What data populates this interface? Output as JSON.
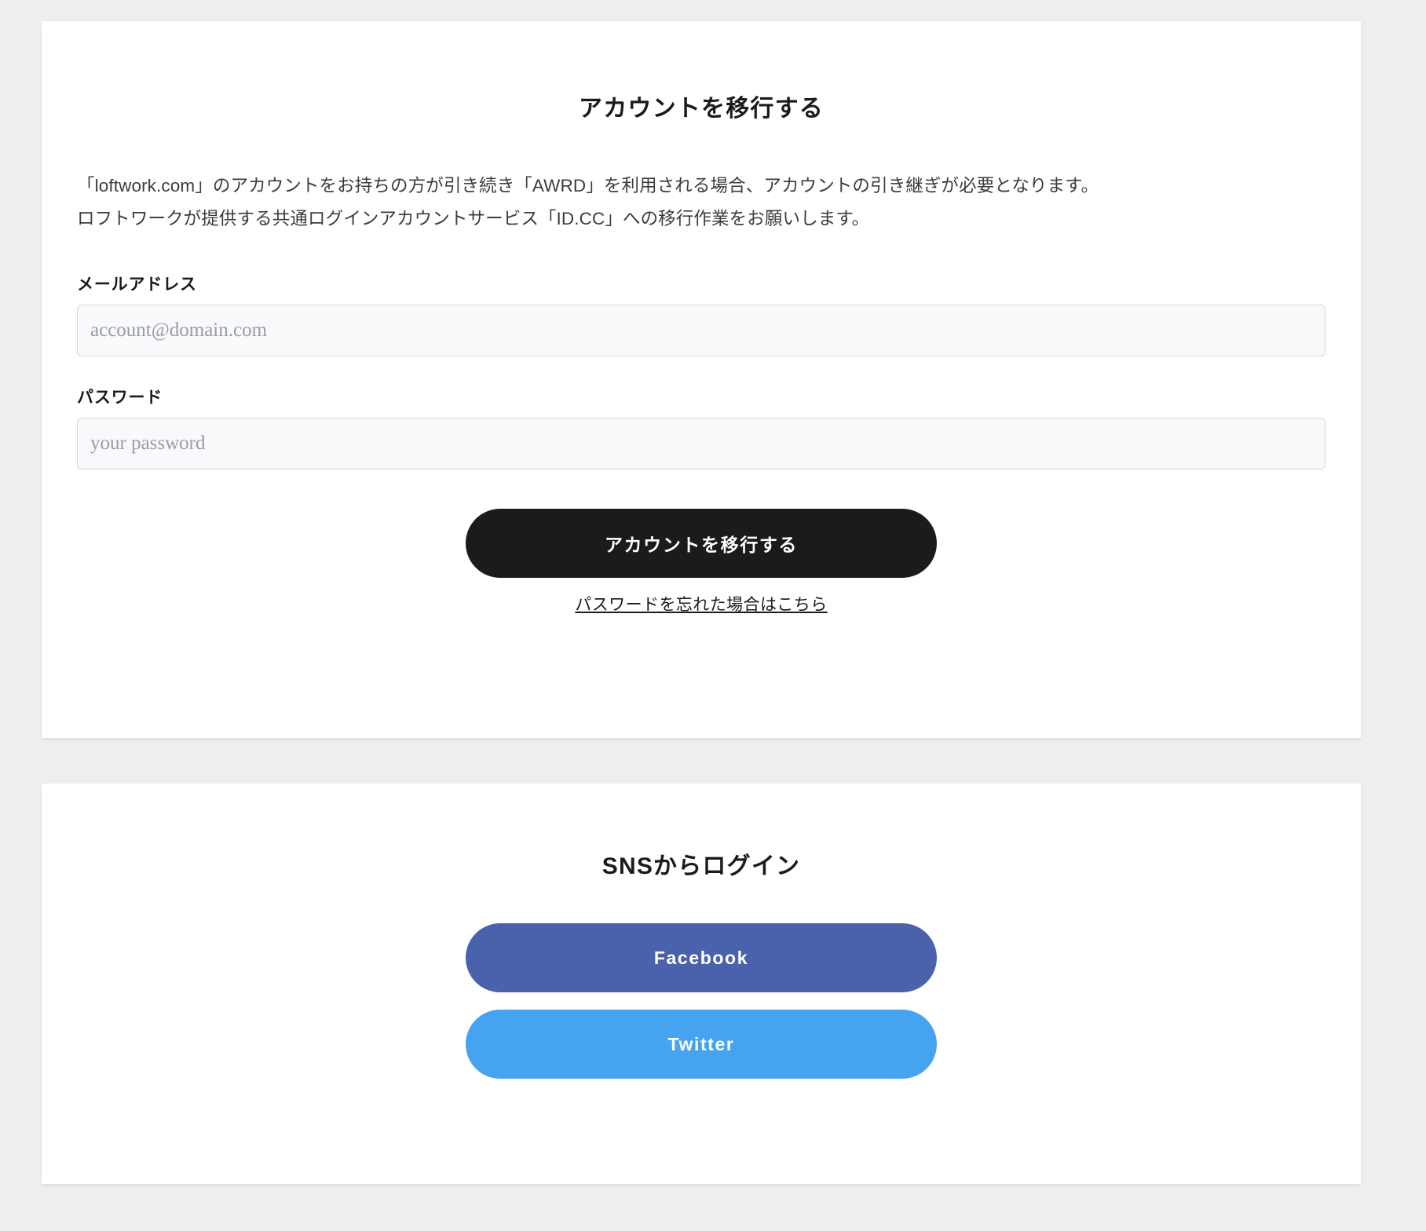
{
  "colors": {
    "page_background": "#eeeeee",
    "card_background": "#ffffff",
    "submit_button": "#1b1b1b",
    "facebook_button": "#4a62ab",
    "twitter_button": "#45a3f0",
    "input_background": "#f8f9fb",
    "input_border": "#d6d8de"
  },
  "migrate_card": {
    "title": "アカウントを移行する",
    "intro_line_1": "「loftwork.com」のアカウントをお持ちの方が引き続き「AWRD」を利用される場合、アカウントの引き継ぎが必要となります。",
    "intro_line_2": "ロフトワークが提供する共通ログインアカウントサービス「ID.CC」への移行作業をお願いします。",
    "email": {
      "label": "メールアドレス",
      "value": "",
      "placeholder": "account@domain.com"
    },
    "password": {
      "label": "パスワード",
      "value": "",
      "placeholder": "your password"
    },
    "submit_label": "アカウントを移行する",
    "forgot_password_link": "パスワードを忘れた場合はこちら"
  },
  "sns_card": {
    "title": "SNSからログイン",
    "buttons": [
      {
        "label": "Facebook"
      },
      {
        "label": "Twitter"
      }
    ]
  }
}
